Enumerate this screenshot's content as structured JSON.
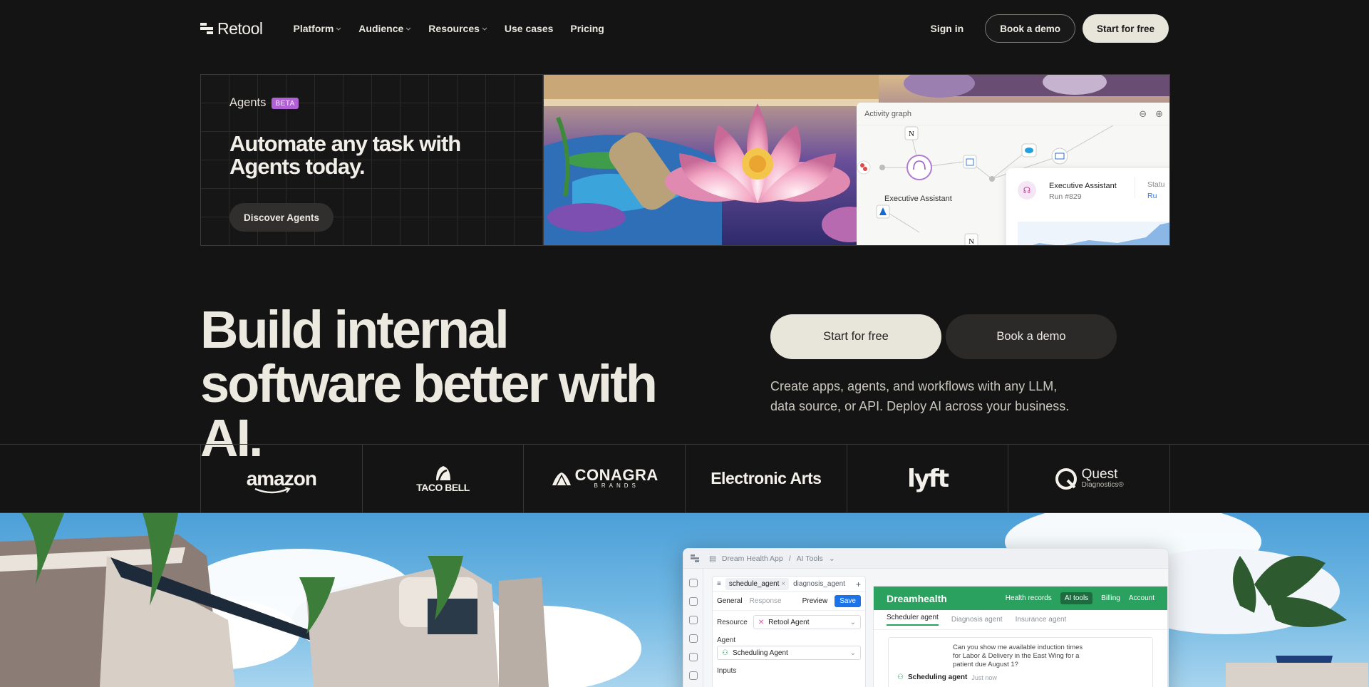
{
  "nav": {
    "brand": "Retool",
    "menu": [
      {
        "label": "Platform",
        "has_dropdown": true
      },
      {
        "label": "Audience",
        "has_dropdown": true
      },
      {
        "label": "Resources",
        "has_dropdown": true
      },
      {
        "label": "Use cases",
        "has_dropdown": false
      },
      {
        "label": "Pricing",
        "has_dropdown": false
      }
    ],
    "sign_in": "Sign in",
    "book_demo": "Book a demo",
    "start_free": "Start for free"
  },
  "promo": {
    "tag": "Agents",
    "badge": "BETA",
    "title": "Automate any task with Agents today.",
    "cta": "Discover Agents",
    "activity_graph": {
      "title": "Activity graph",
      "node_label": "Executive Assistant",
      "card_title": "Executive Assistant",
      "card_run": "Run #829",
      "card_status_label": "Statu",
      "card_status_value": "Ru"
    }
  },
  "hero": {
    "title": "Build internal software better with AI.",
    "cta_primary": "Start for free",
    "cta_secondary": "Book a demo",
    "subtitle": "Create apps, agents, and workflows with any LLM, data source, or API. Deploy AI across your business."
  },
  "customers": {
    "amazon": "amazon",
    "taco_bell": "TACO BELL",
    "conagra": "CONAGRA",
    "conagra_sub": "BRANDS",
    "ea": "Electronic Arts",
    "lyft": "lyft",
    "quest": "Quest",
    "quest_sub": "Diagnostics®"
  },
  "showcase": {
    "breadcrumb_app": "Dream Health App",
    "breadcrumb_sep": "/",
    "breadcrumb_page": "AI Tools",
    "tab_active": "schedule_agent",
    "tab_close": "×",
    "tab_other": "diagnosis_agent",
    "tab_add": "+",
    "sub_general": "General",
    "sub_response": "Response",
    "sub_preview": "Preview",
    "sub_save": "Save",
    "resource_label": "Resource",
    "resource_value": "Retool Agent",
    "agent_label": "Agent",
    "agent_value": "Scheduling Agent",
    "inputs_label": "Inputs",
    "app_brand": "Dreamhealth",
    "app_nav": [
      "Health records",
      "AI tools",
      "Billing",
      "Account"
    ],
    "app_tabs": [
      "Scheduler agent",
      "Diagnosis agent",
      "Insurance agent"
    ],
    "chat_message": "Can you show me available induction times for Labor & Delivery in the East Wing for a patient due August 1?",
    "agent_name": "Scheduling agent",
    "agent_time": "Just now"
  },
  "colors": {
    "background": "#151414",
    "cta_light": "#e8e6da",
    "beta_badge": "#b061d4",
    "app_green": "#2aa15f",
    "save_blue": "#1a73e8"
  }
}
